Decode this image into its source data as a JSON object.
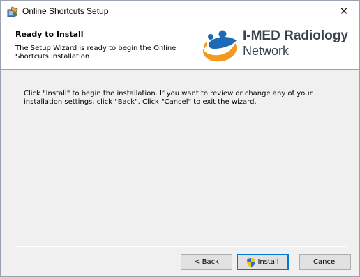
{
  "window": {
    "title": "Online Shortcuts Setup",
    "app_icon": "installer-icon",
    "close_glyph": "✕"
  },
  "banner": {
    "heading": "Ready to Install",
    "description": "The Setup Wizard is ready to begin the Online Shortcuts installation",
    "logo": {
      "line1": "I-MED Radiology",
      "line2": "Network",
      "mark": "imed-logo-icon",
      "colors": {
        "orange": "#f39a1e",
        "blue": "#1f6ab5",
        "text": "#3a4450"
      }
    }
  },
  "content": {
    "instructions": "Click \"Install\" to begin the installation.  If you want to review or change any of your installation settings, click \"Back\".  Click \"Cancel\" to exit the wizard."
  },
  "buttons": {
    "back": "< Back",
    "install": "Install",
    "cancel": "Cancel",
    "install_icon": "uac-shield-icon"
  }
}
